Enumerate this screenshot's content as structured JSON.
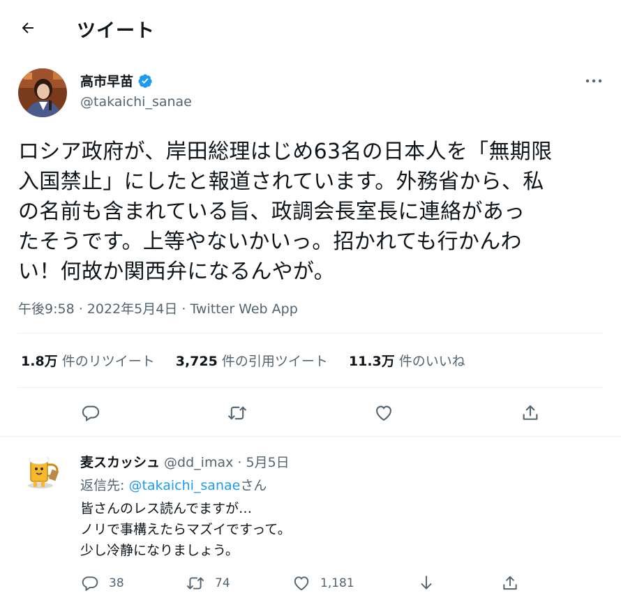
{
  "header": {
    "title": "ツイート"
  },
  "tweet": {
    "author_name": "高市早苗",
    "author_handle": "@takaichi_sanae",
    "text_lines": [
      "ロシア政府が、岸田総理はじめ63名の日本人を「無期限",
      "入国禁止」にしたと報道されています。外務省から、私",
      "の名前も含まれている旨、政調会長室長に連絡があっ",
      "たそうです。上等やないかいっ。招かれても行かんわ",
      "い！何故か関西弁になるんやが。"
    ],
    "time": "午後9:58",
    "separator": " · ",
    "date": "2022年5月4日",
    "source": "Twitter Web App"
  },
  "stats": {
    "retweets_count": "1.8万",
    "retweets_label": " 件のリツイート",
    "quotes_count": "3,725",
    "quotes_label": " 件の引用ツイート",
    "likes_count": "11.3万",
    "likes_label": " 件のいいね"
  },
  "reply": {
    "author_name": "麦スカッシュ",
    "author_handle": " @dd_imax",
    "date": " · 5月5日",
    "reply_to_prefix": "返信先: ",
    "reply_to_mention": "@takaichi_sanae",
    "reply_to_suffix": "さん",
    "lines": [
      "皆さんのレス読んでますが…",
      "ノリで事構えたらマズイですって。",
      "少し冷静になりましょう。"
    ],
    "reply_count": "38",
    "retweet_count": "74",
    "like_count": "1,181"
  },
  "colors": {
    "accent": "#1d9bf0",
    "text": "#0f1419",
    "secondary": "#536471",
    "divider": "#eff3f4"
  }
}
